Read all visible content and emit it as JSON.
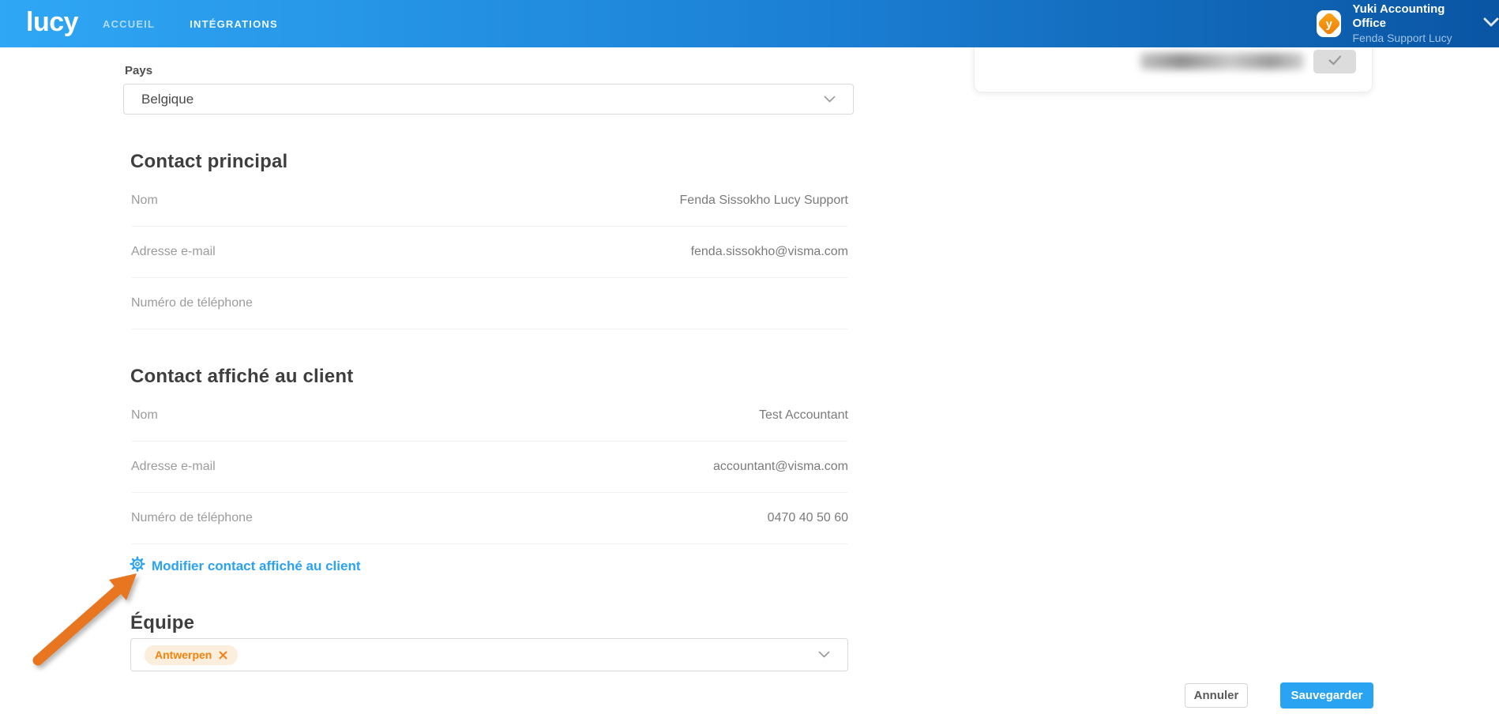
{
  "header": {
    "logo": "lucy",
    "nav": [
      {
        "label": "ACCUEIL"
      },
      {
        "label": "INTÉGRATIONS"
      }
    ],
    "account": {
      "org": "Yuki Accounting Office",
      "user": "Fenda Support Lucy",
      "avatar_letter": "y"
    }
  },
  "top_card": {
    "description": "partially visible card with blurred value and confirm check button",
    "check_icon": "check-mark"
  },
  "form": {
    "pays": {
      "label": "Pays",
      "value": "Belgique"
    },
    "sections": [
      {
        "title": "Contact principal",
        "rows": [
          {
            "label": "Nom",
            "value": "Fenda Sissokho Lucy Support"
          },
          {
            "label": "Adresse e-mail",
            "value": "fenda.sissokho@visma.com"
          },
          {
            "label": "Numéro de téléphone",
            "value": ""
          }
        ]
      },
      {
        "title": "Contact affiché au client",
        "rows": [
          {
            "label": "Nom",
            "value": "Test Accountant"
          },
          {
            "label": "Adresse e-mail",
            "value": "accountant@visma.com"
          },
          {
            "label": "Numéro de téléphone",
            "value": "0470 40 50 60"
          }
        ]
      }
    ],
    "modify_link": "Modifier contact affiché au client",
    "equipe": {
      "title": "Équipe",
      "tags": [
        {
          "label": "Antwerpen"
        }
      ]
    },
    "actions": {
      "cancel": "Annuler",
      "save": "Sauvegarder"
    }
  },
  "colors": {
    "header_gradient_start": "#2fa7f4",
    "header_gradient_end": "#0a55a4",
    "accent_blue": "#2aa3f3",
    "tag_orange": "#f5820d",
    "tag_bg": "#fceedc",
    "arrow_orange": "#e8751f",
    "divider": "#f0f0f0"
  }
}
